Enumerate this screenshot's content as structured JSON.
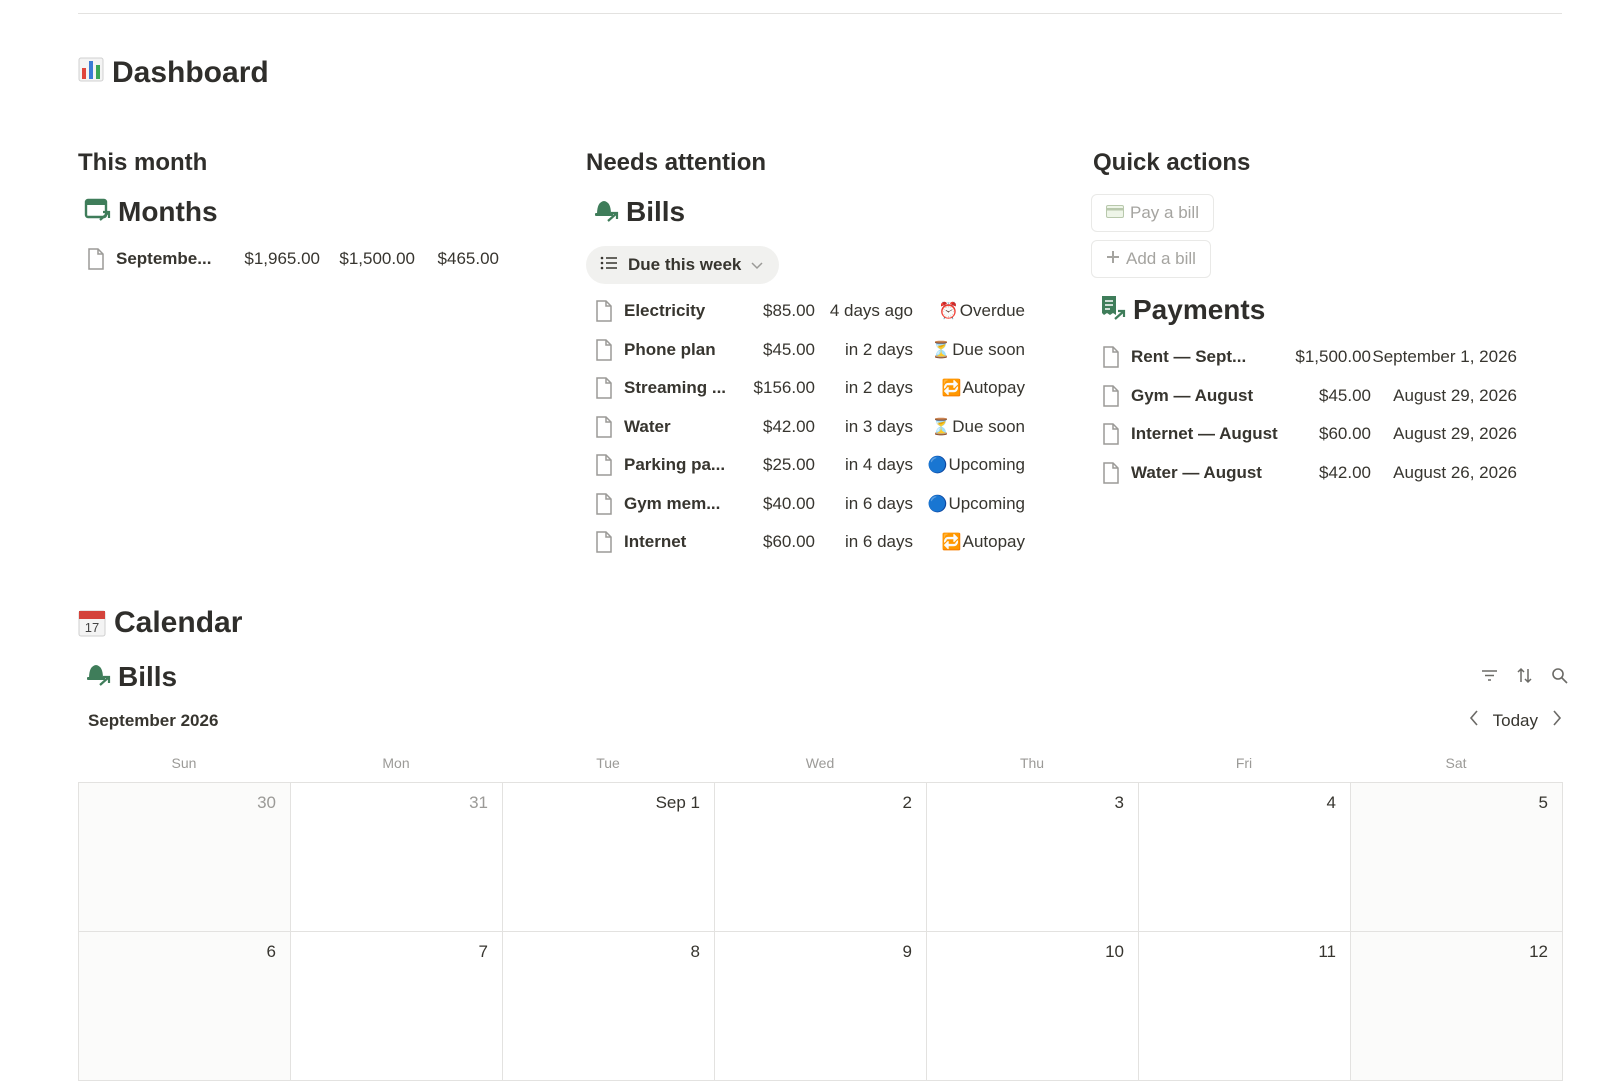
{
  "page": {
    "title": "Dashboard",
    "title_icon": "bar-chart-icon"
  },
  "this_month": {
    "heading": "This month",
    "db_title": "Months",
    "rows": [
      {
        "name": "Septembe...",
        "v1": "$1,965.00",
        "v2": "$1,500.00",
        "v3": "$465.00"
      }
    ]
  },
  "needs_attention": {
    "heading": "Needs attention",
    "db_title": "Bills",
    "view_label": "Due this week",
    "rows": [
      {
        "name": "Electricity",
        "amount": "$85.00",
        "when": "4 days ago",
        "status_icon": "⏰",
        "status": "Overdue"
      },
      {
        "name": "Phone plan",
        "amount": "$45.00",
        "when": "in 2 days",
        "status_icon": "⏳",
        "status": "Due soon"
      },
      {
        "name": "Streaming ...",
        "amount": "$156.00",
        "when": "in 2 days",
        "status_icon": "🔁",
        "status": "Autopay"
      },
      {
        "name": "Water",
        "amount": "$42.00",
        "when": "in 3 days",
        "status_icon": "⏳",
        "status": "Due soon"
      },
      {
        "name": "Parking pa...",
        "amount": "$25.00",
        "when": "in 4 days",
        "status_icon": "🔵",
        "status": "Upcoming"
      },
      {
        "name": "Gym mem...",
        "amount": "$40.00",
        "when": "in 6 days",
        "status_icon": "🔵",
        "status": "Upcoming"
      },
      {
        "name": "Internet",
        "amount": "$60.00",
        "when": "in 6 days",
        "status_icon": "🔁",
        "status": "Autopay"
      }
    ]
  },
  "quick_actions": {
    "heading": "Quick actions",
    "pay_label": "Pay a bill",
    "add_label": "Add a bill",
    "payments_title": "Payments",
    "payments": [
      {
        "name": "Rent — Sept...",
        "amount": "$1,500.00",
        "date": "September 1, 2026"
      },
      {
        "name": "Gym — August",
        "amount": "$45.00",
        "date": "August 29, 2026"
      },
      {
        "name": "Internet — August",
        "amount": "$60.00",
        "date": "August 29, 2026"
      },
      {
        "name": "Water — August",
        "amount": "$42.00",
        "date": "August 26, 2026"
      }
    ]
  },
  "calendar": {
    "heading": "Calendar",
    "heading_icon_day": "17",
    "db_title": "Bills",
    "month_label": "September 2026",
    "today_label": "Today",
    "weekdays": [
      "Sun",
      "Mon",
      "Tue",
      "Wed",
      "Thu",
      "Fri",
      "Sat"
    ],
    "days": [
      "30",
      "31",
      "Sep 1",
      "2",
      "3",
      "4",
      "5",
      "6",
      "7",
      "8",
      "9",
      "10",
      "11",
      "12"
    ]
  },
  "colors": {
    "accent_green": "#3f7d5a",
    "text": "#37352f",
    "muted": "#9b9a97",
    "border": "#e3e2e0"
  }
}
